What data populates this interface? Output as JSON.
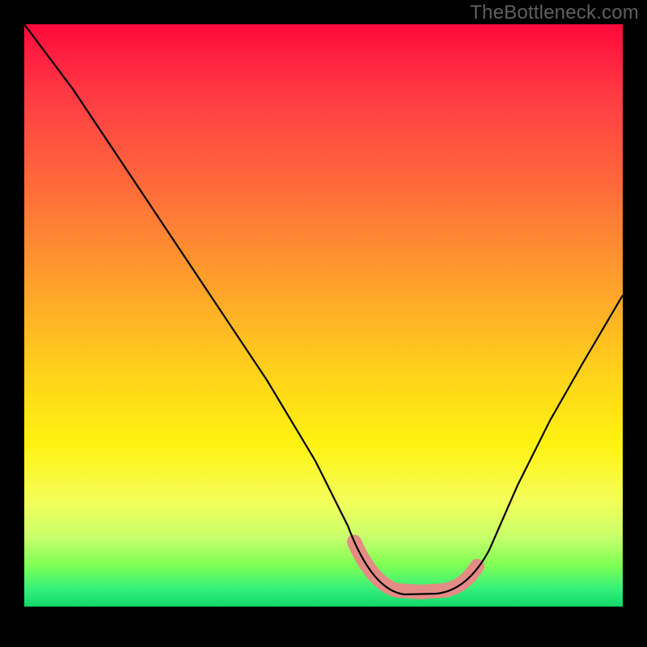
{
  "watermark": "TheBottleneck.com",
  "chart_data": {
    "type": "line",
    "title": "",
    "xlabel": "",
    "ylabel": "",
    "xlim": [
      0,
      100
    ],
    "ylim": [
      0,
      100
    ],
    "x": [
      0,
      5,
      10,
      15,
      20,
      25,
      30,
      35,
      40,
      45,
      50,
      55,
      60,
      63,
      66,
      70,
      75,
      80,
      85,
      90,
      95,
      100
    ],
    "values": [
      100,
      92,
      84,
      76,
      68,
      60,
      52,
      44,
      36,
      28,
      20,
      12,
      5,
      2,
      2,
      2,
      4,
      12,
      22,
      34,
      45,
      55
    ],
    "valley_highlight_x": [
      55,
      75
    ],
    "gradient_stops": [
      {
        "pos": 0,
        "color": "#ff0a3a"
      },
      {
        "pos": 12,
        "color": "#ff3a44"
      },
      {
        "pos": 28,
        "color": "#ff6b3a"
      },
      {
        "pos": 45,
        "color": "#ffa22a"
      },
      {
        "pos": 60,
        "color": "#ffd21a"
      },
      {
        "pos": 72,
        "color": "#fff210"
      },
      {
        "pos": 82,
        "color": "#f3ff5a"
      },
      {
        "pos": 88,
        "color": "#c8ff6a"
      },
      {
        "pos": 93,
        "color": "#7dff55"
      },
      {
        "pos": 97,
        "color": "#34f07a"
      },
      {
        "pos": 100,
        "color": "#12d96a"
      }
    ],
    "colors": {
      "curve": "#000000",
      "highlight": "#e58b85",
      "background_frame": "#000000"
    }
  }
}
